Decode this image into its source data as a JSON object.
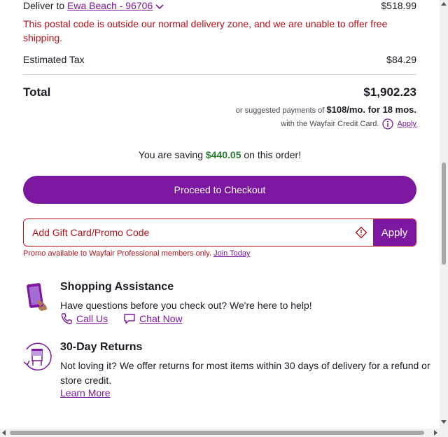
{
  "delivery": {
    "prefix": "Deliver to",
    "location": "Ewa Beach - 96706",
    "amount": "$518.99",
    "error": "This postal code is outside our normal delivery zone, and we are unable to offer free shipping."
  },
  "tax": {
    "label": "Estimated Tax",
    "amount": "$84.29"
  },
  "total": {
    "label": "Total",
    "amount": "$1,902.23",
    "financing_prefix": "or suggested payments of",
    "financing_terms": "$108/mo. for 18 mos.",
    "financing_card": "with the Wayfair Credit Card.",
    "apply_link": "Apply"
  },
  "savings": {
    "prefix": "You are saving",
    "amount": "$440.05",
    "suffix": "on this order!"
  },
  "checkout_button": "Proceed to Checkout",
  "promo": {
    "placeholder": "Add Gift Card/Promo Code",
    "apply_label": "Apply",
    "note": "Promo available to Wayfair Professional members only.",
    "join_link": "Join Today"
  },
  "assistance": {
    "title": "Shopping Assistance",
    "text": "Have questions before you check out? We're here to help!",
    "call_label": "Call Us",
    "chat_label": "Chat Now"
  },
  "returns": {
    "title": "30-Day Returns",
    "text": "Not loving it? We offer returns for most items within 30 days of delivery for a refund or store credit.",
    "learn_more": "Learn More"
  },
  "colors": {
    "brand": "#7b189f",
    "error": "#b3121b",
    "savings": "#2e7d32"
  },
  "icons": [
    "chevron-down-icon",
    "info-icon",
    "diamond-alert-icon",
    "phone-hand-icon",
    "phone-icon",
    "chat-icon",
    "returns-nightstand-icon"
  ]
}
